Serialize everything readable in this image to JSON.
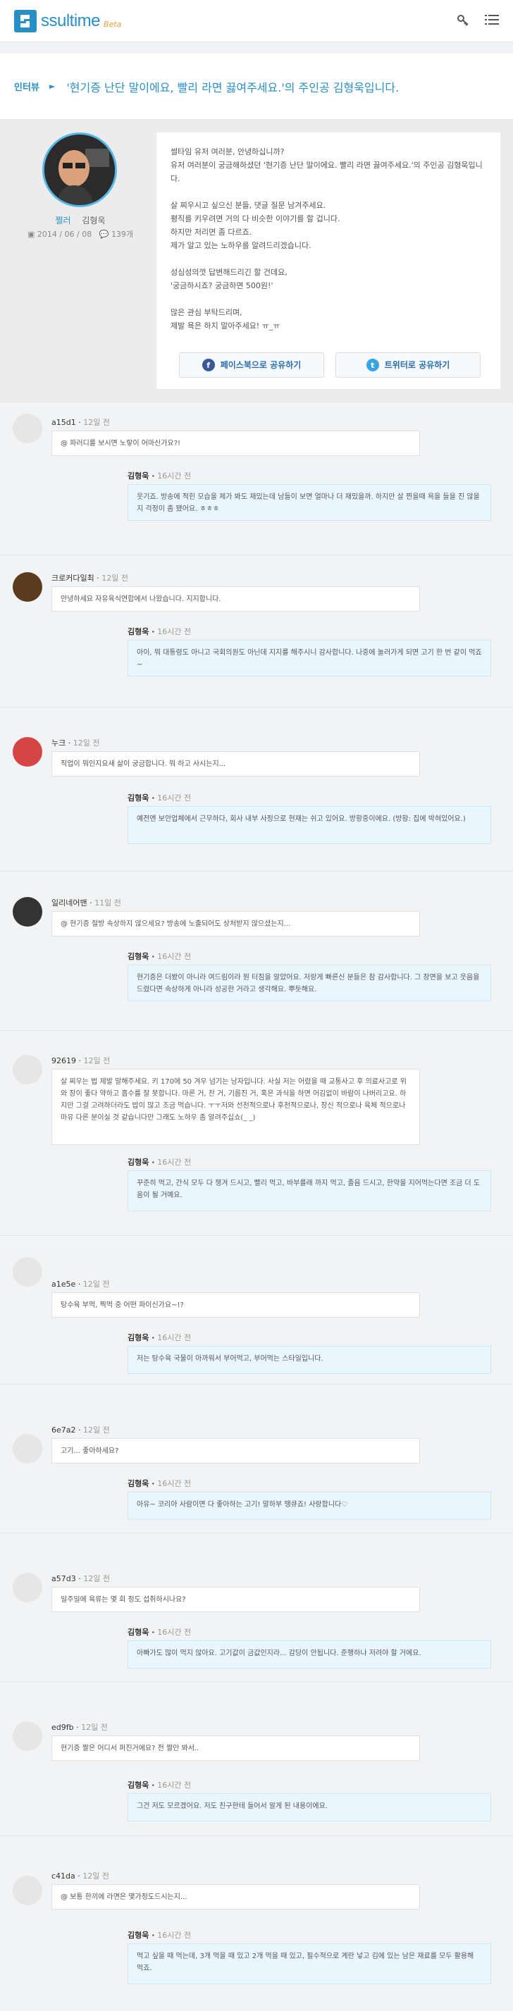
{
  "header": {
    "logo_text": "ssultime",
    "logo_badge": "Beta",
    "icons": [
      "key-icon",
      "menu-icon"
    ]
  },
  "title": {
    "tag": "인터뷰",
    "arrow": "►",
    "text": "'현기증 난단 말이에요, 빨리 라면 끓여주세요.'의 주인공 김형욱입니다."
  },
  "profile": {
    "nickname": "쩔러",
    "name": "김형욱",
    "date": "2014 / 06 / 08",
    "comment_count": "139개"
  },
  "intro": [
    "썰타임 유저 여러분, 안녕하십니까?",
    "유저 여러분이 궁금해하셨던 '현기증 난단 말이에요. 빨리 라면 끓여주세요.'의 주인공 김형욱입니다.",
    "",
    "살 찌우시고 싶으신 분들, 댓글 질문 남겨주세요.",
    "평직를 키우려면 거의 다 비슷한 이야기를 할 겁니다.",
    "하지만 저리면 좀 다르죠.",
    "제가 알고 있는 노하우를 알려드리겠습니다.",
    "",
    "성심성의껏 답변해드리긴 할 건데요,",
    "'궁금하시죠? 궁금하면 500원!'",
    "",
    "많은 관심 부탁드리며,",
    "제발 욕은 하지 말아주세요! ㅠ_ㅠ"
  ],
  "share": {
    "facebook": "페이스북으로 공유하기",
    "twitter": "트위터로 공유하기"
  },
  "qa": [
    {
      "user": "a15d1",
      "time": "12일 전",
      "q": "@ 파러디를 보시면 노랗이 어마신가요?!",
      "responder": "김형욱",
      "atime": "16시간 전",
      "a": "웃기죠. 방송에 적힌 모습을 제가 봐도 재밌는데 남들이 보면 얼마나 더 재밌을까. 하지만 살 찐을때 욕을 들을 진 않을지 걱정이 좀 됐어요. ㅎㅎㅎ"
    },
    {
      "user": "크로커다일최",
      "time": "12일 전",
      "q": "안녕하세요 자유육식연합에서 나왔습니다. 지지합니다.",
      "responder": "김형욱",
      "atime": "16시간 전",
      "a": "아이, 뭐 대통령도 아니고 국회의원도 아닌데 지지를 해주시니 감사합니다. 나중에 놀러가게 되면 고기 한 번 같이 먹죠~"
    },
    {
      "user": "누크",
      "time": "12일 전",
      "q": "직업이 뭐인지요새 삶이 궁금합니다. 뭐 하고 사시는지...",
      "responder": "김형욱",
      "atime": "16시간 전",
      "a": "예전엔 보안업체에서 근무하다, 회사 내부 사정으로 현재는 쉬고 있어요. 방황중이에요. (방황: 집에 박혀있어요.)"
    },
    {
      "user": "일리네어맨",
      "time": "11일 전",
      "q": "@ 현기증 절방 속상하지 않으세요? 방송에 노출되어도 상처받지 않으셨는지...",
      "responder": "김형욱",
      "atime": "16시간 전",
      "a": "현기증은 더봤이 아니라 여드림이라 뭔 터짐을 알았어요. 저랑게 빠른신 분들은 참 감사합니다. 그 장면을 보고 웃음을 드렸다면 속상하게 아니라 성공한 거라고 생각해요. 뿌듯해요."
    },
    {
      "user": "92619",
      "time": "12일 전",
      "q": "살 찌우는 법 제발 말해주세요. 키 170에 50 겨우 넘기는 남자입니다. 사실 저는 어렸을 때 교통사고 후 의료사고로 위와 장이 좋다 약하고 흡수를 잘 못합니다. 마른 거, 찬 거, 기름진 거, 혹은 과식을 하면 어김없이 바람이 나버리고요. 하지만 그걸 고려하더라도 밥이 많고 조금 먹습니다. ㅜㅜ저와 선천적으로나 후천적으로나, 장신 적으로나 육체 적으로나 마유 다른 분이실 것 같습니다만 그래도 노하우 좀 알려주십쇼(_ _)",
      "responder": "김형욱",
      "atime": "16시간 전",
      "a": "꾸준히 먹고, 간식 모두 다 챙겨 드시고, 빨리 먹고, 바부를래 까지 먹고, 졸음 드시고, 한약을 지어먹는다면 조금 더 도움이 될 거예요."
    },
    {
      "user": "a1e5e",
      "time": "12일 전",
      "q": "탕수육 부먹, 찍먹 중 어떤 파이신가요~!?",
      "responder": "김형욱",
      "atime": "16시간 전",
      "a": "저는 탕수육 국물이 아까워서 부어먹고, 부어먹는 스타일입니다."
    },
    {
      "user": "6e7a2",
      "time": "12일 전",
      "q": "고기... 좋아하세요?",
      "responder": "김형욱",
      "atime": "16시간 전",
      "a": "아유~ 코리아 사람이면 다 좋아하는 고기! 말하부 땡큐죠! 사랑합니다♡"
    },
    {
      "user": "a57d3",
      "time": "12일 전",
      "q": "일주일에 육류는 몇 회 정도 섭취하시나요?",
      "responder": "김형욱",
      "atime": "16시간 전",
      "a": "아빠가도 많이 먹지 않아요. 고기값이 금값인지라... 감당이 안됩니다. 준행하나 저려야 할 거에요."
    },
    {
      "user": "ed9fb",
      "time": "12일 전",
      "q": "현기증 짤은 어디서 퍼진거에요? 전 짤만 봐서..",
      "responder": "김형욱",
      "atime": "16시간 전",
      "a": "그건 저도 모르겠어요. 저도 친구한테 들어서 알게 된 내용이에요."
    },
    {
      "user": "c41da",
      "time": "12일 전",
      "q": "@ 보통 한끼에 라면은 몇가정도드시는지...",
      "responder": "김형욱",
      "atime": "16시간 전",
      "a": "먹고 싶을 때 먹는데, 3개 먹을 때 있고 2개 먹을 때 있고, 필수적으로 계란 넣고 김에 있는 남은 재료를 모두 활용해 먹죠."
    }
  ]
}
